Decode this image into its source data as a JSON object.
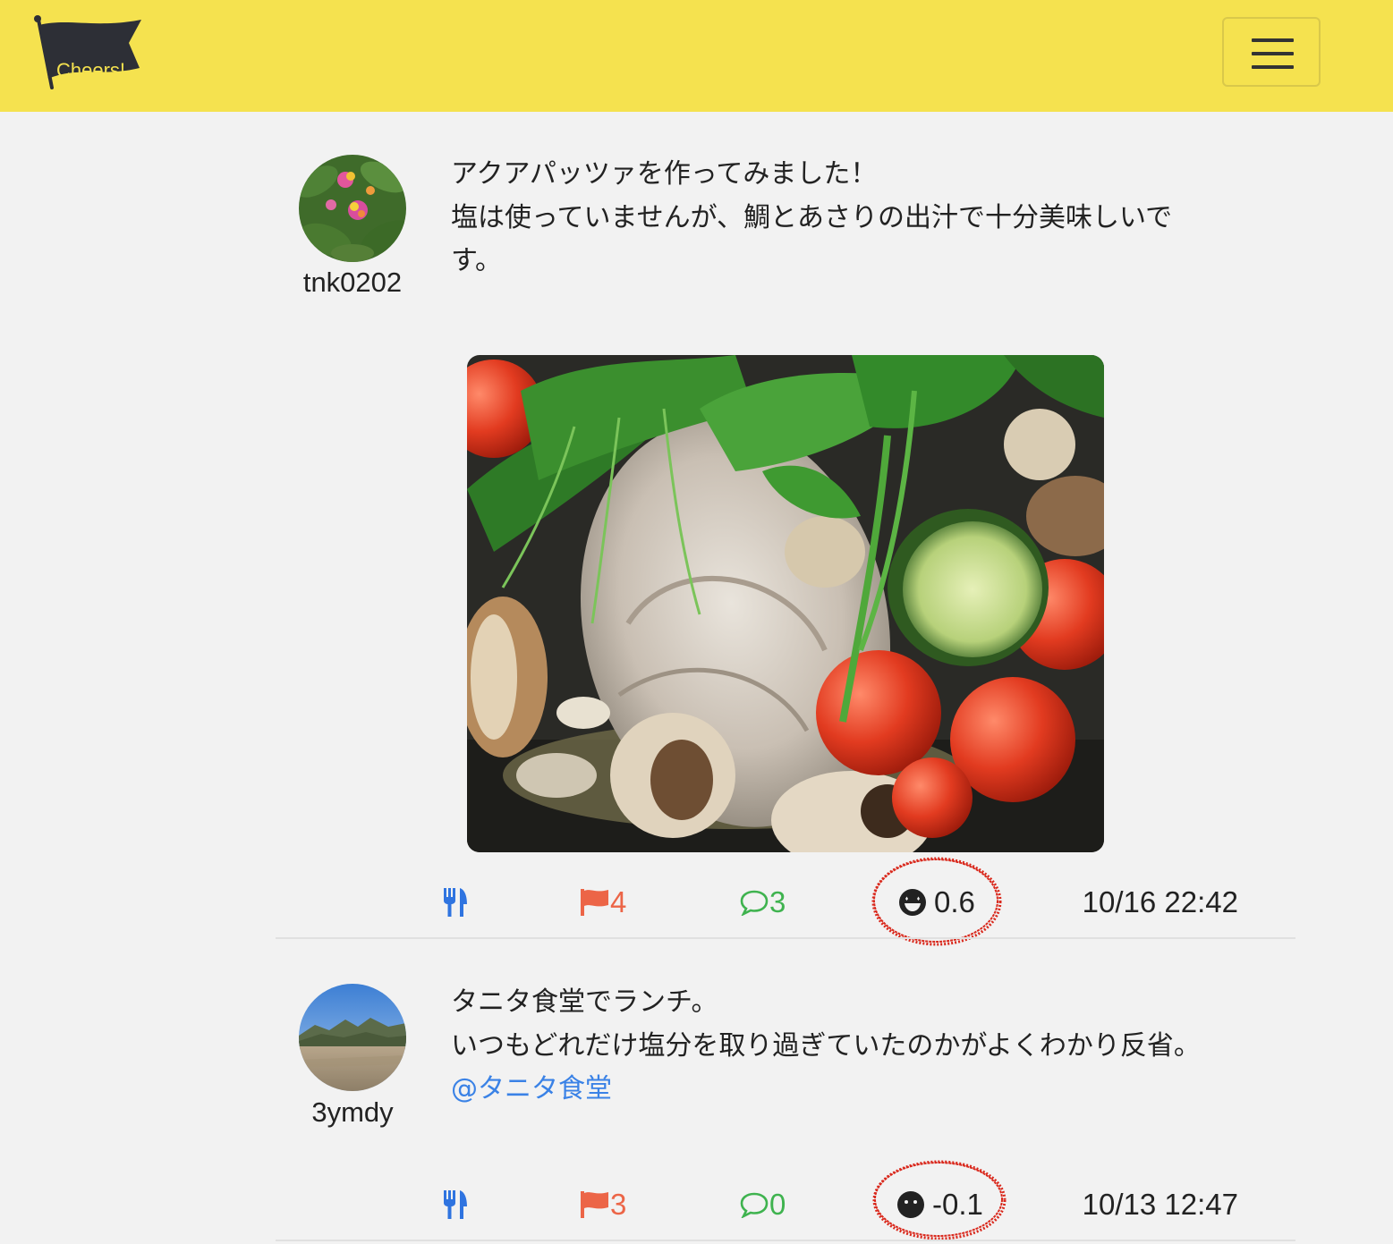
{
  "navbar": {
    "brand_text": "Cheers!",
    "brand_icon": "flag-logo",
    "menu_icon": "hamburger-icon",
    "background_color": "#f5e24f"
  },
  "posts": [
    {
      "username": "tnk0202",
      "text_lines": [
        "アクアパッツァを作ってみました！",
        "塩は使っていませんが、鯛とあさりの出汁で十分美味しいで",
        "す。"
      ],
      "mention": "",
      "has_photo": true,
      "photo_subject": "acqua pazza",
      "actions": {
        "fork_icon": "fork-knife-icon",
        "flag_count": "4",
        "comment_count": "3",
        "mood_icon": "grinning-star-eyes-icon",
        "mood_score": "0.6",
        "timestamp": "10/16 22:42"
      }
    },
    {
      "username": "3ymdy",
      "text_lines": [
        "タニタ食堂でランチ。",
        "いつもどれだけ塩分を取り過ぎていたのかがよくわかり反省。"
      ],
      "mention": "@タニタ食堂",
      "has_photo": false,
      "actions": {
        "fork_icon": "fork-knife-icon",
        "flag_count": "3",
        "comment_count": "0",
        "mood_icon": "neutral-face-icon",
        "mood_score": "-0.1",
        "timestamp": "10/13 12:47"
      }
    }
  ],
  "colors": {
    "flag": "#ec6547",
    "comment": "#3fb34f",
    "fork": "#2f74e0",
    "mention": "#3a82e6",
    "annotation_circle": "#d9281c"
  }
}
